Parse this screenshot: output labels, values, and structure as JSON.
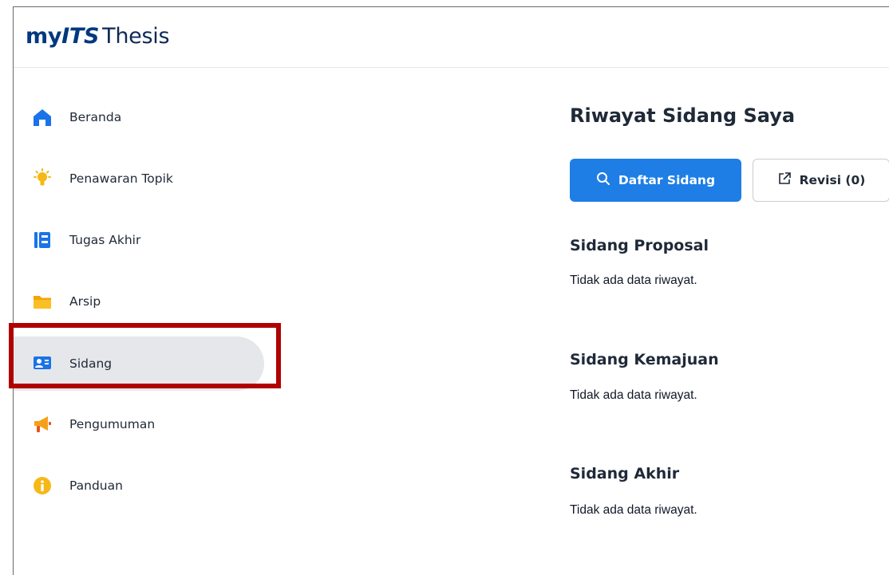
{
  "app": {
    "brand_my": "my",
    "brand_its": "ITS",
    "brand_thesis": "Thesis"
  },
  "sidebar": {
    "items": [
      {
        "label": "Beranda",
        "icon": "home-icon"
      },
      {
        "label": "Penawaran Topik",
        "icon": "lightbulb-icon"
      },
      {
        "label": "Tugas Akhir",
        "icon": "book-icon"
      },
      {
        "label": "Arsip",
        "icon": "folder-icon"
      },
      {
        "label": "Sidang",
        "icon": "presentation-icon",
        "active": true
      },
      {
        "label": "Pengumuman",
        "icon": "megaphone-icon"
      },
      {
        "label": "Panduan",
        "icon": "info-icon"
      }
    ]
  },
  "main": {
    "title": "Riwayat Sidang Saya",
    "daftar_button": "Daftar Sidang",
    "revisi_button": "Revisi (0)",
    "sections": [
      {
        "title": "Sidang Proposal",
        "empty": "Tidak ada data riwayat."
      },
      {
        "title": "Sidang Kemajuan",
        "empty": "Tidak ada data riwayat."
      },
      {
        "title": "Sidang Akhir",
        "empty": "Tidak ada data riwayat."
      }
    ]
  },
  "colors": {
    "primary": "#1e7ee6",
    "brand": "#013880",
    "highlight": "#b00000"
  }
}
